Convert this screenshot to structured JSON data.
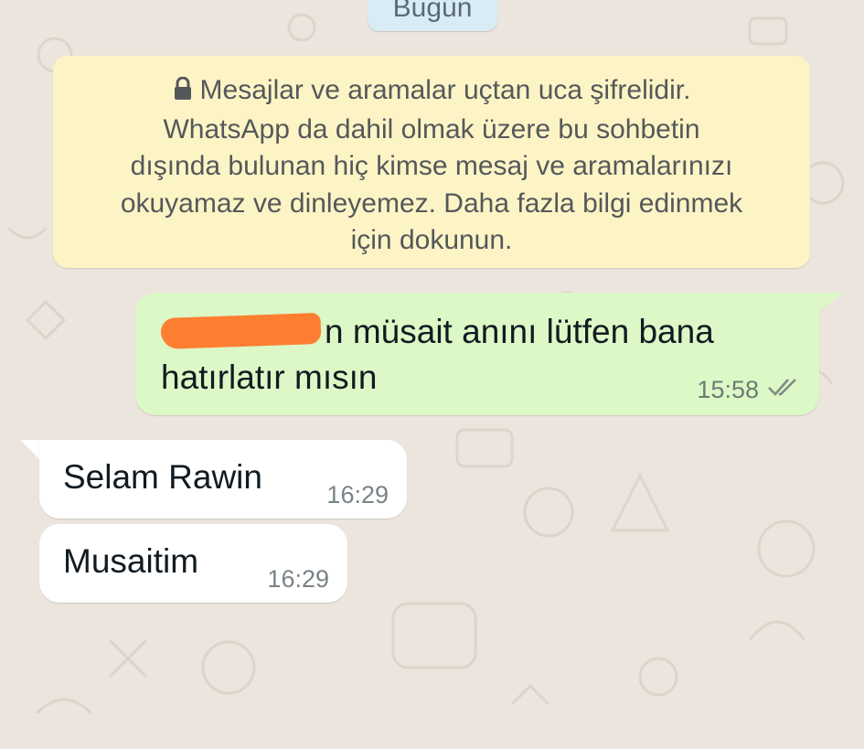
{
  "date_chip": {
    "label": "Bugün"
  },
  "encryption_notice": {
    "lines": [
      "Mesajlar ve aramalar uçtan uca şifrelidir.",
      "WhatsApp da dahil olmak üzere bu sohbetin",
      "dışında bulunan hiç kimse mesaj ve aramalarınızı",
      "okuyamaz ve dinleyemez. Daha fazla bilgi edinmek",
      "için dokunun."
    ],
    "icon": "lock-icon"
  },
  "messages": [
    {
      "direction": "outgoing",
      "redacted": true,
      "text_line1": "n müsait anını lütfen bana",
      "text_line2": "hatırlatır mısın",
      "time": "15:58",
      "status_icon": "double-check-icon"
    },
    {
      "direction": "incoming",
      "text": "Selam Rawin",
      "time": "16:29"
    },
    {
      "direction": "incoming",
      "text": "Musaitim",
      "time": "16:29"
    }
  ],
  "colors": {
    "wallpaper": "#ece5dd",
    "outgoing_bubble": "#dcf8c6",
    "incoming_bubble": "#ffffff",
    "notice_bubble": "#fdf4c5",
    "date_chip": "#d9ecf5",
    "redaction": "#ff7f32"
  }
}
